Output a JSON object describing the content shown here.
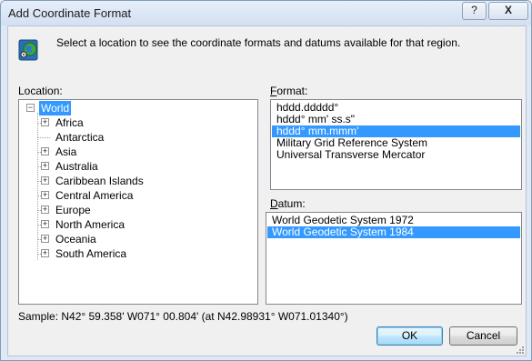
{
  "window": {
    "title": "Add Coordinate Format",
    "help_label": "?",
    "close_label": "X"
  },
  "intro_text": "Select a location to see the coordinate formats and datums available for that region.",
  "location": {
    "label": "Location:",
    "root": "World",
    "items": [
      {
        "label": "Africa",
        "expandable": true
      },
      {
        "label": "Antarctica",
        "expandable": false
      },
      {
        "label": "Asia",
        "expandable": true
      },
      {
        "label": "Australia",
        "expandable": true
      },
      {
        "label": "Caribbean Islands",
        "expandable": true
      },
      {
        "label": "Central America",
        "expandable": true
      },
      {
        "label": "Europe",
        "expandable": true
      },
      {
        "label": "North America",
        "expandable": true
      },
      {
        "label": "Oceania",
        "expandable": true
      },
      {
        "label": "South America",
        "expandable": true
      }
    ]
  },
  "format": {
    "label": "Format:",
    "items": [
      "hddd.ddddd°",
      "hddd° mm' ss.s\"",
      "hddd° mm.mmm'",
      "Military Grid Reference System",
      "Universal Transverse Mercator"
    ],
    "selected": "hddd° mm.mmm'"
  },
  "datum": {
    "label": "Datum:",
    "items": [
      "World Geodetic System 1972",
      "World Geodetic System 1984"
    ],
    "selected": "World Geodetic System 1984"
  },
  "sample_text": "Sample: N42° 59.358'  W071° 00.804' (at N42.98931°  W071.01340°)",
  "buttons": {
    "ok": "OK",
    "cancel": "Cancel"
  },
  "colors": {
    "selection": "#3399ff",
    "title_bar": "#dfe8f4"
  }
}
